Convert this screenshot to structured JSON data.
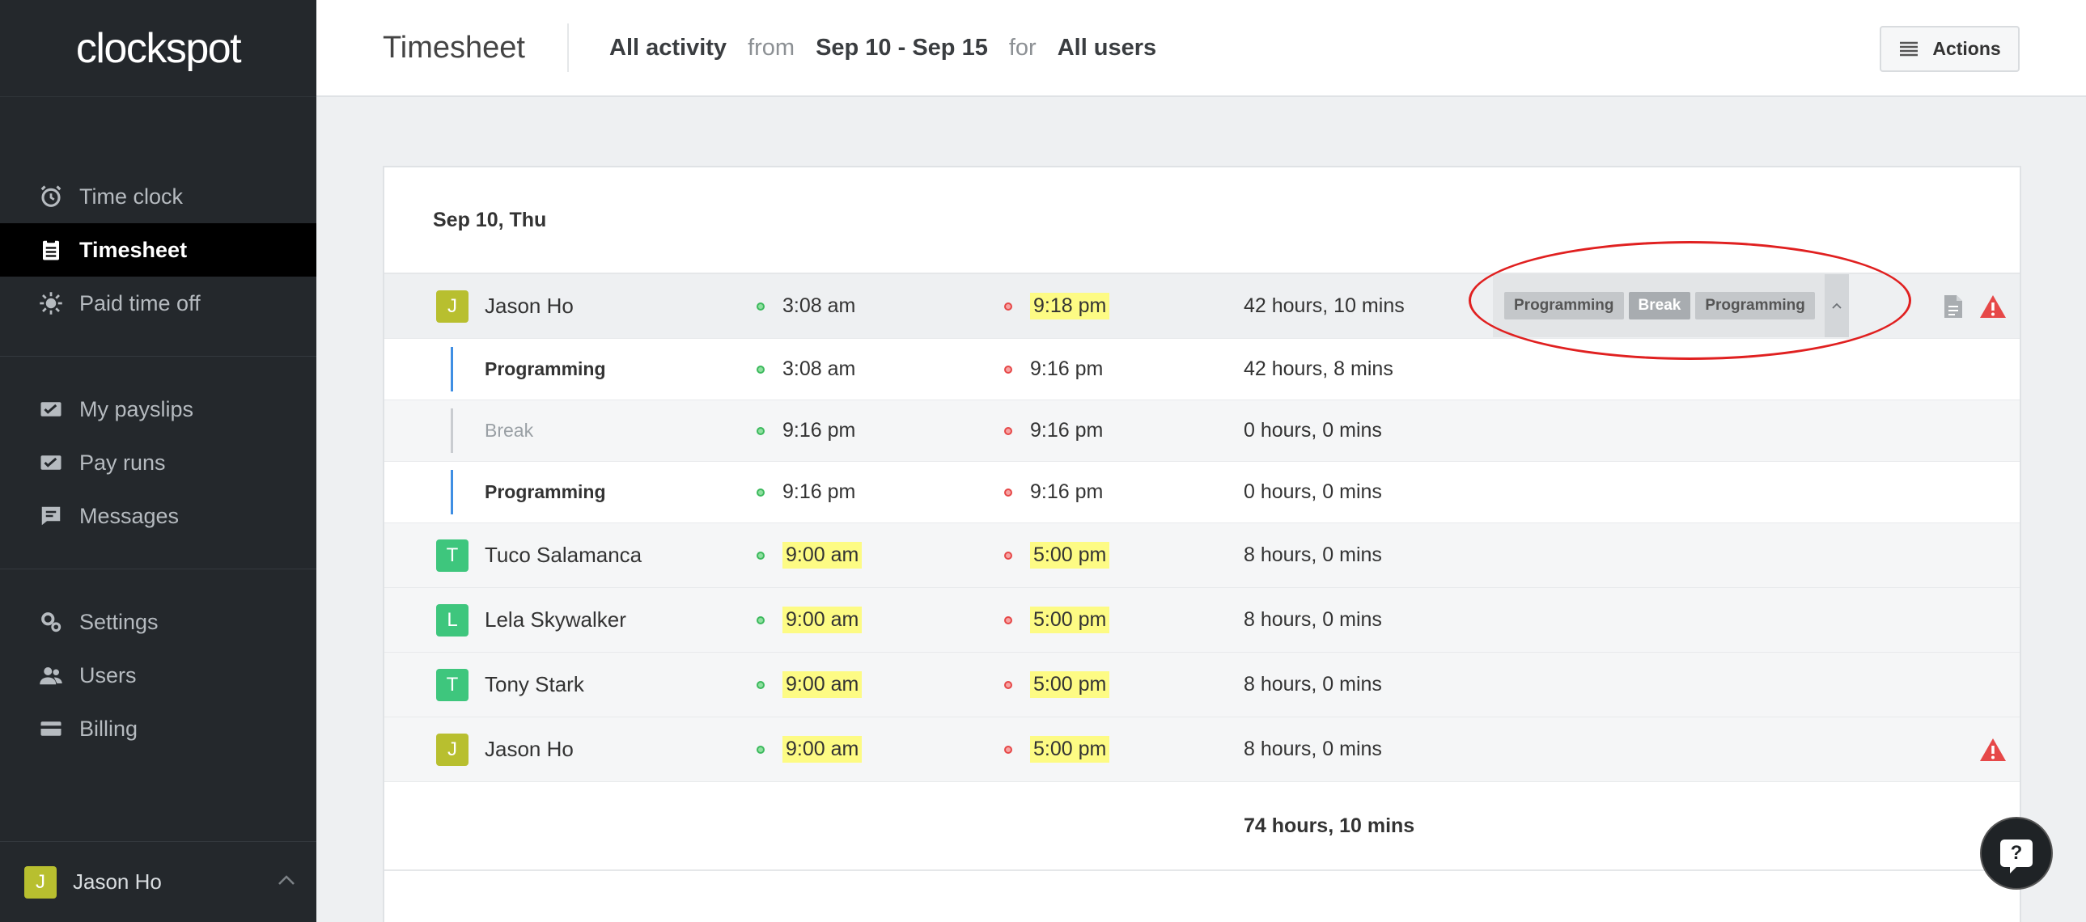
{
  "app": {
    "logo": "clockspot"
  },
  "sidebar": {
    "group1": [
      {
        "label": "Time clock",
        "icon": "alarm-clock-icon",
        "active": false
      },
      {
        "label": "Timesheet",
        "icon": "timesheet-icon",
        "active": true
      },
      {
        "label": "Paid time off",
        "icon": "sun-icon",
        "active": false
      }
    ],
    "group2": [
      {
        "label": "My payslips",
        "icon": "payslip-icon"
      },
      {
        "label": "Pay runs",
        "icon": "pay-run-icon"
      },
      {
        "label": "Messages",
        "icon": "message-icon"
      }
    ],
    "group3": [
      {
        "label": "Settings",
        "icon": "gear-icon"
      },
      {
        "label": "Users",
        "icon": "users-icon"
      },
      {
        "label": "Billing",
        "icon": "credit-card-icon"
      }
    ],
    "user": {
      "initial": "J",
      "name": "Jason Ho"
    }
  },
  "header": {
    "title": "Timesheet",
    "activity": "All activity",
    "from_word": "from",
    "date_range": "Sep 10 - Sep 15",
    "for_word": "for",
    "users": "All users",
    "actions_label": "Actions"
  },
  "day": {
    "label": "Sep 10, Thu",
    "rows": [
      {
        "initial": "J",
        "name": "Jason Ho",
        "in": "3:08  am",
        "out": "9:18  pm",
        "duration": "42 hours, 10 mins"
      },
      {
        "initial": "T",
        "name": "Tuco Salamanca",
        "in": "9:00  am",
        "out": "5:00  pm",
        "duration": "8 hours, 0 mins"
      },
      {
        "initial": "L",
        "name": "Lela Skywalker",
        "in": "9:00  am",
        "out": "5:00  pm",
        "duration": "8 hours, 0 mins"
      },
      {
        "initial": "T",
        "name": "Tony Stark",
        "in": "9:00  am",
        "out": "5:00  pm",
        "duration": "8 hours, 0 mins"
      },
      {
        "initial": "J",
        "name": "Jason Ho",
        "in": "9:00  am",
        "out": "5:00  pm",
        "duration": "8 hours, 0 mins"
      }
    ],
    "tags": [
      "Programming",
      "Break",
      "Programming"
    ],
    "segments": [
      {
        "name": "Programming",
        "in": "3:08  am",
        "out": "9:16  pm",
        "duration": "42 hours, 8 mins"
      },
      {
        "name": "Break",
        "in": "9:16  pm",
        "out": "9:16  pm",
        "duration": "0 hours, 0 mins"
      },
      {
        "name": "Programming",
        "in": "9:16  pm",
        "out": "9:16  pm",
        "duration": "0 hours, 0 mins"
      }
    ],
    "total": "74 hours, 10 mins"
  },
  "colors": {
    "sidebar_bg": "#24282c",
    "active_bg": "#000000",
    "highlight": "#fdfb84",
    "warning": "#e64848",
    "segment_bar": "#3f8ee3"
  }
}
